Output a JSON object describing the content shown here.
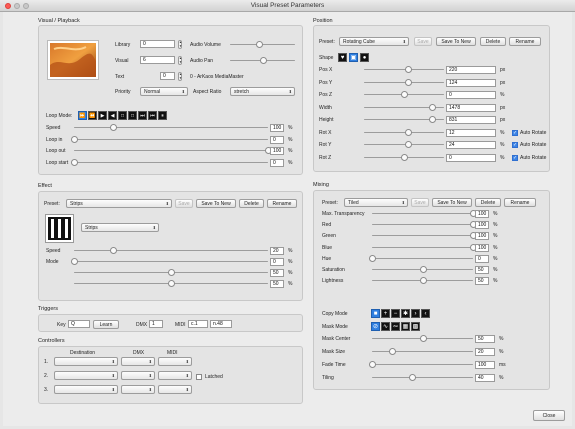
{
  "window": {
    "title": "Visual Preset Parameters"
  },
  "visual": {
    "section": "Visual / Playback",
    "library_label": "Library",
    "library": "0",
    "visual_label": "Visual",
    "visual": "6",
    "text_label": "Text",
    "text": "0",
    "text_desc": "0 - ArKaos MediaMaster",
    "priority_label": "Priority",
    "priority": "Normal",
    "audio_volume_label": "Audio Volume",
    "audio_volume": 0.45,
    "audio_pan_label": "Audio Pan",
    "audio_pan": 0.5,
    "aspect_label": "Aspect Ratio",
    "aspect": "stretch",
    "loop_mode_label": "Loop Mode:",
    "loop_icons": [
      {
        "glyph": "⏩",
        "name": "loop-forward-icon",
        "active": true
      },
      {
        "glyph": "⏪",
        "name": "loop-backward-icon",
        "active": false
      },
      {
        "glyph": "▶",
        "name": "loop-play-icon",
        "active": false
      },
      {
        "glyph": "◀",
        "name": "loop-reverse-icon",
        "active": false
      },
      {
        "glyph": "□",
        "name": "loop-stop-icon",
        "active": false
      },
      {
        "glyph": "□",
        "name": "loop-frame-icon",
        "active": false
      },
      {
        "glyph": "⏭",
        "name": "loop-pingpong-icon",
        "active": false
      },
      {
        "glyph": "⏮",
        "name": "loop-bounce-icon",
        "active": false
      },
      {
        "glyph": "⏸",
        "name": "loop-random-icon",
        "active": false
      }
    ],
    "params": [
      {
        "label": "Speed",
        "value": "100",
        "unit": "%",
        "level": 0.2
      },
      {
        "label": "Loop in",
        "value": "0",
        "unit": "%",
        "level": 0.0
      },
      {
        "label": "Loop out",
        "value": "100",
        "unit": "%",
        "level": 1.0
      },
      {
        "label": "Loop start",
        "value": "0",
        "unit": "%",
        "level": 0.0
      }
    ]
  },
  "effect": {
    "section": "Effect",
    "preset_label": "Preset:",
    "preset": "Strips",
    "save": "Save",
    "save_new": "Save To New",
    "delete": "Delete",
    "rename": "Rename",
    "effect_name": "Strips",
    "speed_label": "Speed",
    "mode_label": "Mode",
    "params": [
      {
        "label": "Speed",
        "value": "20",
        "unit": "%",
        "level": 0.2
      },
      {
        "label": "Mode",
        "value": "0",
        "unit": "%",
        "level": 0.0
      },
      {
        "label": "",
        "value": "50",
        "unit": "%",
        "level": 0.5
      },
      {
        "label": "",
        "value": "50",
        "unit": "%",
        "level": 0.5
      }
    ]
  },
  "triggers": {
    "section": "Triggers",
    "key_label": "Key",
    "key": "Q",
    "learn": "Learn",
    "dmx_label": "DMX",
    "dmx": "1",
    "midi_label": "MIDI",
    "midi_ch": "c.1",
    "midi_note": "n.48"
  },
  "controllers": {
    "section": "Controllers",
    "col_dest": "Destination",
    "col_dmx": "DMX",
    "col_midi": "MIDI",
    "rows": [
      "1.",
      "2.",
      "3."
    ],
    "latched": "Latched"
  },
  "position": {
    "section": "Position",
    "preset_label": "Preset:",
    "preset": "Rotating Cube",
    "save": "Save",
    "save_new": "Save To New",
    "delete": "Delete",
    "rename": "Rename",
    "shape_label": "Shape",
    "auto_rotate": "Auto Rotate",
    "params": [
      {
        "label": "Pos X",
        "value": "220",
        "unit": "px",
        "level": 0.55,
        "auto": false
      },
      {
        "label": "Pos Y",
        "value": "124",
        "unit": "px",
        "level": 0.55,
        "auto": false
      },
      {
        "label": "Pos Z",
        "value": "0",
        "unit": "%",
        "level": 0.5,
        "auto": false
      },
      {
        "label": "Width",
        "value": "1478",
        "unit": "px",
        "level": 0.85,
        "auto": false
      },
      {
        "label": "Height",
        "value": "831",
        "unit": "px",
        "level": 0.85,
        "auto": false
      },
      {
        "label": "Rot X",
        "value": "12",
        "unit": "%",
        "level": 0.55,
        "auto": true
      },
      {
        "label": "Rot Y",
        "value": "24",
        "unit": "%",
        "level": 0.55,
        "auto": true
      },
      {
        "label": "Rot Z",
        "value": "0",
        "unit": "%",
        "level": 0.5,
        "auto": true
      }
    ]
  },
  "mixing": {
    "section": "Mixing",
    "preset_label": "Preset:",
    "preset": "Tiled",
    "save": "Save",
    "save_new": "Save To New",
    "delete": "Delete",
    "rename": "Rename",
    "copy_mode_label": "Copy Mode",
    "mask_mode_label": "Mask Mode",
    "params": [
      {
        "label": "Max. Transparency",
        "value": "100",
        "unit": "%",
        "level": 1.0
      },
      {
        "label": "Red",
        "value": "100",
        "unit": "%",
        "level": 1.0
      },
      {
        "label": "Green",
        "value": "100",
        "unit": "%",
        "level": 1.0
      },
      {
        "label": "Blue",
        "value": "100",
        "unit": "%",
        "level": 1.0
      },
      {
        "label": "Hue",
        "value": "0",
        "unit": "%",
        "level": 0.0
      },
      {
        "label": "Saturation",
        "value": "50",
        "unit": "%",
        "level": 0.5
      },
      {
        "label": "Lightness",
        "value": "50",
        "unit": "%",
        "level": 0.5
      }
    ],
    "params2": [
      {
        "label": "Mask Center",
        "value": "50",
        "unit": "%",
        "level": 0.5
      },
      {
        "label": "Mask Size",
        "value": "20",
        "unit": "%",
        "level": 0.2
      },
      {
        "label": "Fade Time",
        "value": "100",
        "unit": "ms",
        "level": 0.0
      },
      {
        "label": "Tiling",
        "value": "40",
        "unit": "%",
        "level": 0.4
      }
    ]
  },
  "footer": {
    "close": "Close"
  }
}
